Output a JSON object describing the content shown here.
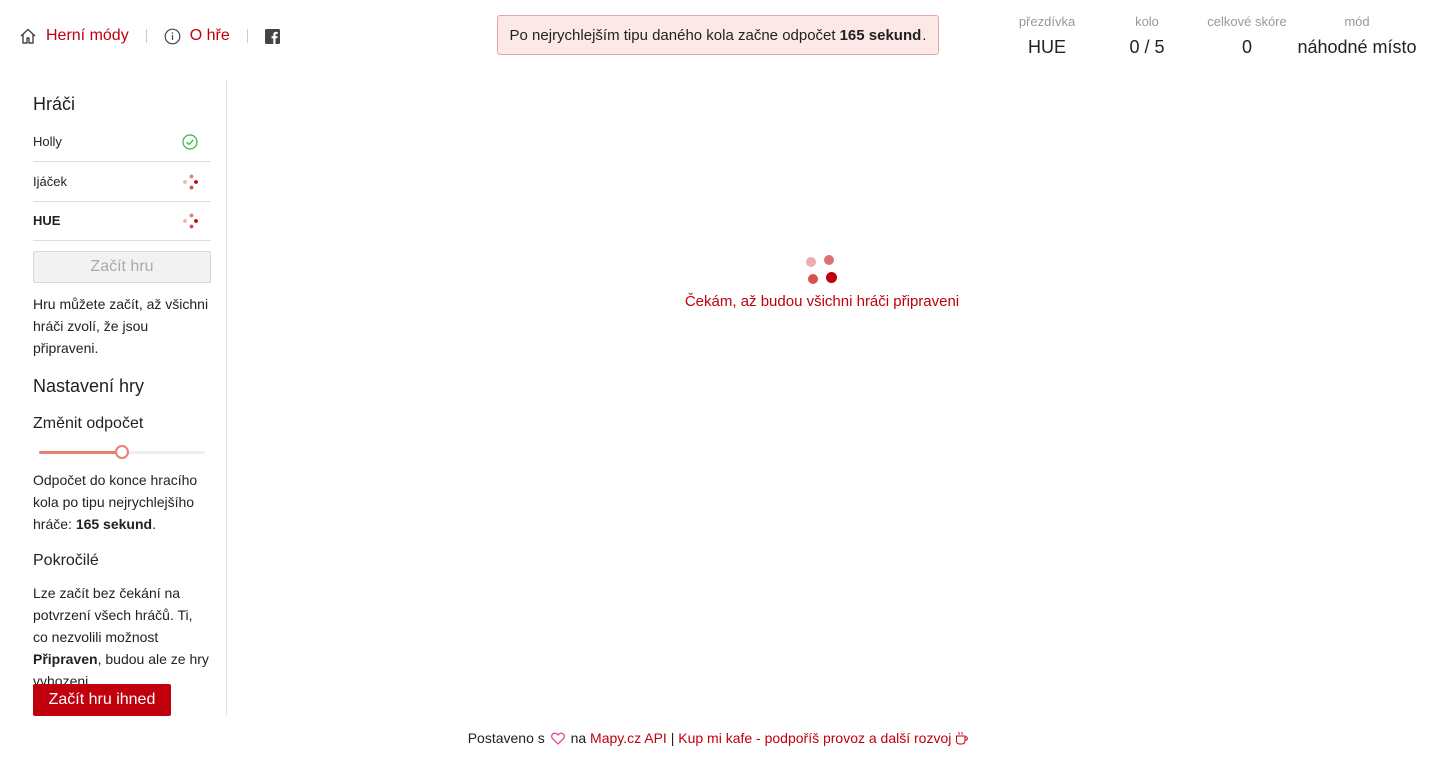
{
  "nav": {
    "modes_label": "Herní módy",
    "about_label": "O hře"
  },
  "banner": {
    "prefix": "Po nejrychlejším tipu daného kola začne odpočet",
    "seconds": "165 sekund",
    "suffix": "."
  },
  "stats": [
    {
      "label": "přezdívka",
      "value": "HUE"
    },
    {
      "label": "kolo",
      "value": "0 / 5"
    },
    {
      "label": "celkové skóre",
      "value": "0"
    },
    {
      "label": "mód",
      "value": "náhodné místo"
    }
  ],
  "sidebar": {
    "players_title": "Hráči",
    "players": [
      {
        "name": "Holly",
        "status": "ready"
      },
      {
        "name": "Ijáček",
        "status": "waiting"
      },
      {
        "name": "HUE",
        "status": "waiting"
      }
    ],
    "start_button": "Začít hru",
    "start_hint": "Hru můžete začít, až všichni hráči zvolí, že jsou připraveni.",
    "settings_title": "Nastavení hry",
    "countdown_title": "Změnit odpočet",
    "countdown_level": 0.5,
    "countdown_desc_prefix": "Odpočet do konce hracího kola po tipu nejrychlejšího hráče:",
    "countdown_desc_value": "165 sekund",
    "countdown_desc_suffix": ".",
    "advanced_title": "Pokročilé",
    "advanced_desc_prefix": "Lze začít bez čekání na potvrzení všech hráčů. Ti, co nezvolili možnost",
    "advanced_desc_bold": "Připraven",
    "advanced_desc_suffix": ", budou ale ze hry vyhozeni.",
    "instant_button": "Začít hru ihned"
  },
  "main": {
    "waiting_text": "Čekám, až budou všichni hráči připraveni"
  },
  "footer": {
    "built_with": "Postaveno s",
    "on": "na",
    "api_link": "Mapy.cz API",
    "separator": "|",
    "coffee_link": "Kup mi kafe - podpoříš provoz a další rozvoj"
  },
  "colors": {
    "accent": "#c0000c",
    "ready": "#3cb43c",
    "slider": "#e9806e"
  }
}
